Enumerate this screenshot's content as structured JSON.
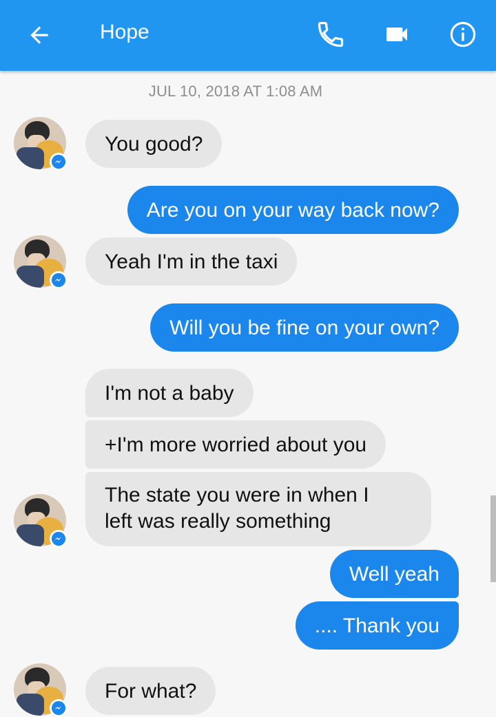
{
  "header": {
    "title": "Hope",
    "back_icon": "arrow-left-icon",
    "call_icon": "phone-icon",
    "video_icon": "video-camera-icon",
    "info_icon": "info-icon",
    "background_color": "#2196f0"
  },
  "timestamp": "JUL 10, 2018 AT 1:08 AM",
  "messages": [
    {
      "from": "them",
      "text": "You good?"
    },
    {
      "from": "me",
      "text": "Are you on your way back now?"
    },
    {
      "from": "them",
      "text": "Yeah I'm in the taxi"
    },
    {
      "from": "me",
      "text": "Will you be fine on your own?"
    },
    {
      "from": "them",
      "text": "I'm not a baby"
    },
    {
      "from": "them",
      "text": "+I'm more worried about you"
    },
    {
      "from": "them",
      "text": "The state you were in when I"
    },
    {
      "from": "them",
      "text": "left was really something"
    },
    {
      "from": "me",
      "text": "Well yeah"
    },
    {
      "from": "me",
      "text": ".... Thank you"
    },
    {
      "from": "them",
      "text": "For what?"
    }
  ],
  "colors": {
    "incoming_bubble": "#e6e6e6",
    "outgoing_bubble": "#1b87ec",
    "messenger_badge": "#1b87ec"
  }
}
